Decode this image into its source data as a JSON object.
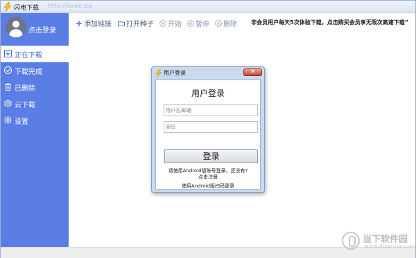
{
  "window": {
    "title": "闪电下载",
    "title_blurred": "http://xxxx.zip"
  },
  "sidebar": {
    "login_label": "点击登录",
    "items": [
      {
        "label": "正在下载",
        "icon": "download-icon",
        "active": true
      },
      {
        "label": "下载完成",
        "icon": "check-circle-icon",
        "active": false
      },
      {
        "label": "已删除",
        "icon": "trash-icon",
        "active": false
      },
      {
        "label": "云下载",
        "icon": "cloud-icon",
        "active": false
      },
      {
        "label": "设置",
        "icon": "gear-icon",
        "active": false
      }
    ]
  },
  "toolbar": {
    "add_link": "添加链接",
    "open_seed": "打开种子",
    "start": "开始",
    "pause": "暂停",
    "delete": "删除",
    "notice": "非会员用户每天5次体验下载，点击购买会员享无限次高速下载”"
  },
  "dialog": {
    "title": "用户登录",
    "close": "✕",
    "heading": "用户登录",
    "username_placeholder": "用户名/邮箱",
    "password_placeholder": "密码",
    "login_button": "登录",
    "hint_line1": "请使用Android版账号登录，还没有?",
    "register_link": "点击注册",
    "qr_login": "使用Android版扫码登录"
  },
  "watermark": {
    "title": "当下软件园",
    "url": "www.downxia.com"
  },
  "colors": {
    "sidebar_bg": "#5a7ee6",
    "active_text": "#3d66d6",
    "close_button": "#c8452f"
  }
}
